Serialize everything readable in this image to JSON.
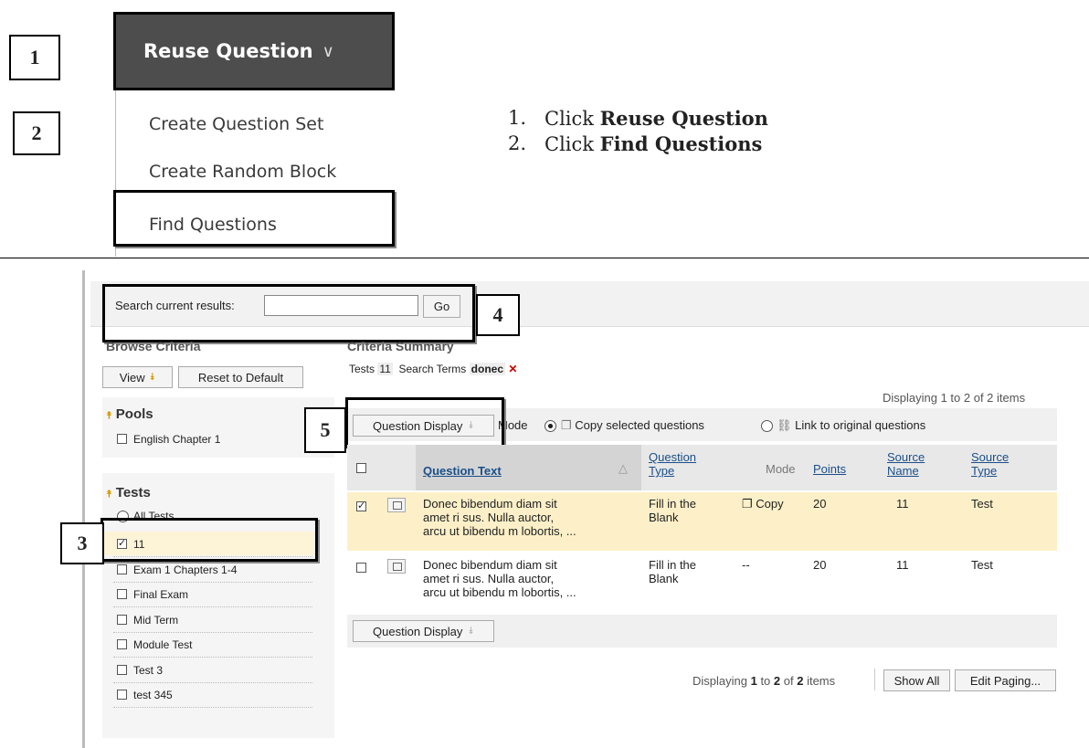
{
  "callouts": {
    "c1": "1",
    "c2": "2",
    "c3": "3",
    "c4": "4",
    "c5": "5"
  },
  "menu": {
    "reuse_label": "Reuse Question",
    "items": [
      "Create Question Set",
      "Create Random Block",
      "Find Questions"
    ]
  },
  "instructions": {
    "step1": {
      "num": "1.",
      "prefix": "Click ",
      "bold": "Reuse Question"
    },
    "step2": {
      "num": "2.",
      "prefix": "Click ",
      "bold": "Find Questions"
    }
  },
  "search": {
    "label": "Search current results:",
    "value": "",
    "go": "Go"
  },
  "browse": {
    "title": "Browse Criteria",
    "view_label": "View",
    "reset_label": "Reset to Default",
    "pools_title": "Pools",
    "pools": [
      "English Chapter 1"
    ],
    "tests_title": "Tests",
    "all_tests": "All Tests",
    "tests": [
      {
        "label": "11",
        "checked": true
      },
      {
        "label": "Exam 1 Chapters 1-4",
        "checked": false
      },
      {
        "label": "Final Exam",
        "checked": false
      },
      {
        "label": "Mid Term",
        "checked": false
      },
      {
        "label": "Module Test",
        "checked": false
      },
      {
        "label": "Test 3",
        "checked": false
      },
      {
        "label": "test 345",
        "checked": false
      }
    ]
  },
  "summary": {
    "title": "Criteria Summary",
    "tests_label": "Tests",
    "tests_value": "11",
    "terms_label": "Search Terms",
    "terms_value": "donec"
  },
  "results": {
    "displaying_top": "Displaying 1 to 2 of 2 items",
    "question_display": "Question Display",
    "mode_label": "Mode",
    "copy_option": "Copy selected questions",
    "link_option": "Link to original questions",
    "columns": {
      "question_text": "Question Text",
      "question_type": "Question Type",
      "mode": "Mode",
      "points": "Points",
      "source_name": "Source Name",
      "source_type": "Source Type"
    },
    "rows": [
      {
        "checked": true,
        "text": "Donec bibendum diam sit amet ri sus. Nulla auctor, arcu ut bibendu m lobortis, ...",
        "type": "Fill in the Blank",
        "mode": "Copy",
        "points": "20",
        "source_name": "11",
        "source_type": "Test"
      },
      {
        "checked": false,
        "text": "Donec bibendum diam sit amet ri sus. Nulla auctor, arcu ut bibendu m lobortis, ...",
        "type": "Fill in the Blank",
        "mode": "--",
        "points": "20",
        "source_name": "11",
        "source_type": "Test"
      }
    ],
    "displaying_bottom_prefix": "Displaying ",
    "displaying_bottom_from": "1",
    "displaying_bottom_mid": " to ",
    "displaying_bottom_to": "2",
    "displaying_bottom_of": " of ",
    "displaying_bottom_total": "2",
    "displaying_bottom_suffix": " items",
    "show_all": "Show All",
    "edit_paging": "Edit Paging..."
  }
}
